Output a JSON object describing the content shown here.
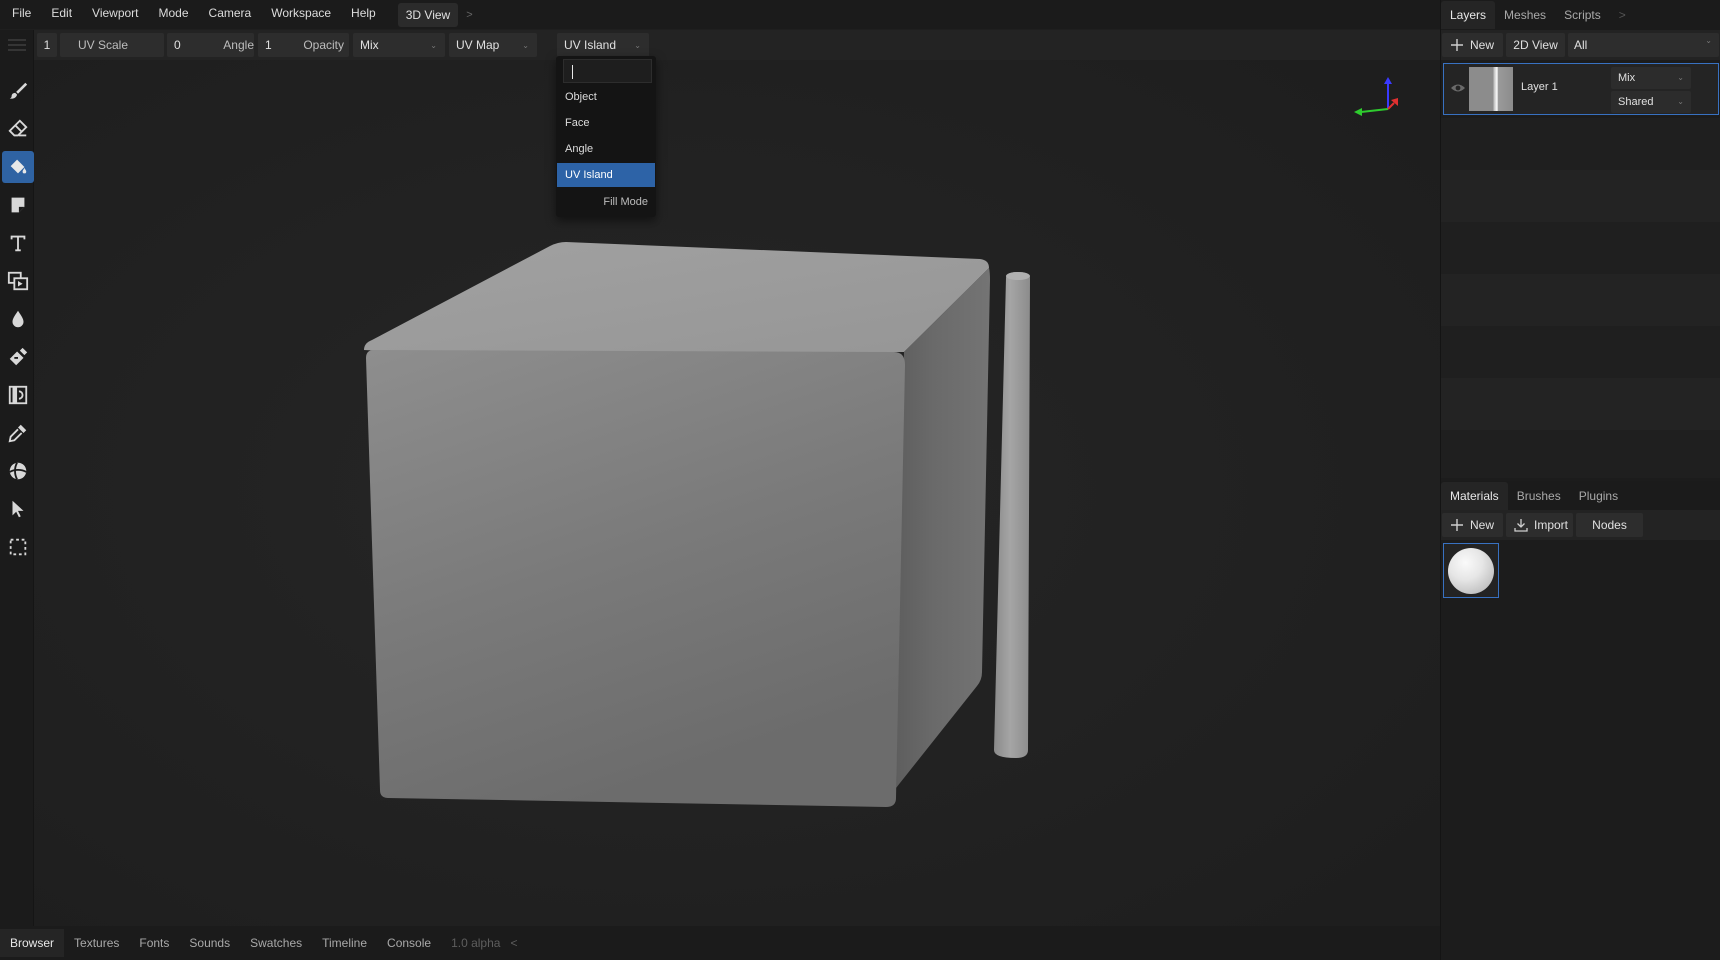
{
  "menu": [
    "File",
    "Edit",
    "Viewport",
    "Mode",
    "Camera",
    "Workspace",
    "Help"
  ],
  "view_tab": "3D View",
  "view_tab_more": ">",
  "toolbar": {
    "brush_radius": "1",
    "uv_scale_label": "UV Scale",
    "uv_scale_value": "0",
    "angle_label": "Angle",
    "angle_value": "1",
    "opacity_label": "Opacity",
    "blend_value": "Mix",
    "map_value": "UV Map",
    "fill_value": "UV Island"
  },
  "fill_dropdown": {
    "search": "",
    "options": [
      "Object",
      "Face",
      "Angle",
      "UV Island"
    ],
    "selected": "UV Island",
    "footer": "Fill Mode"
  },
  "tools": [
    {
      "icon": "brush-icon"
    },
    {
      "icon": "eraser-icon"
    },
    {
      "icon": "fill-bucket-icon",
      "active": true
    },
    {
      "icon": "decal-icon"
    },
    {
      "icon": "text-tool-icon"
    },
    {
      "icon": "clone-icon"
    },
    {
      "icon": "blur-drop-icon"
    },
    {
      "icon": "smudge-icon"
    },
    {
      "icon": "bake-icon"
    },
    {
      "icon": "color-picker-icon"
    },
    {
      "icon": "material-picker-icon"
    },
    {
      "icon": "select-pointer-icon"
    },
    {
      "icon": "marquee-select-icon"
    }
  ],
  "right_panel": {
    "tabs_top": [
      "Layers",
      "Meshes",
      "Scripts"
    ],
    "tabs_top_more": ">",
    "layer_buttons": {
      "new": "New",
      "view2d": "2D View",
      "filter": "All"
    },
    "layer": {
      "name": "Layer 1",
      "blend": "Mix",
      "texture": "Shared"
    },
    "tabs_bottom": [
      "Materials",
      "Brushes",
      "Plugins"
    ],
    "material_buttons": {
      "new": "New",
      "import": "Import",
      "nodes": "Nodes"
    }
  },
  "bottom_tabs": [
    "Browser",
    "Textures",
    "Fonts",
    "Sounds",
    "Swatches",
    "Timeline",
    "Console"
  ],
  "version": "1.0 alpha",
  "bottom_more": "<",
  "colors": {
    "accent": "#2f63a3",
    "selection_outline": "#3871c1",
    "axis_x": "#e03030",
    "axis_y": "#2ecc2e",
    "axis_z": "#3a3aff"
  }
}
